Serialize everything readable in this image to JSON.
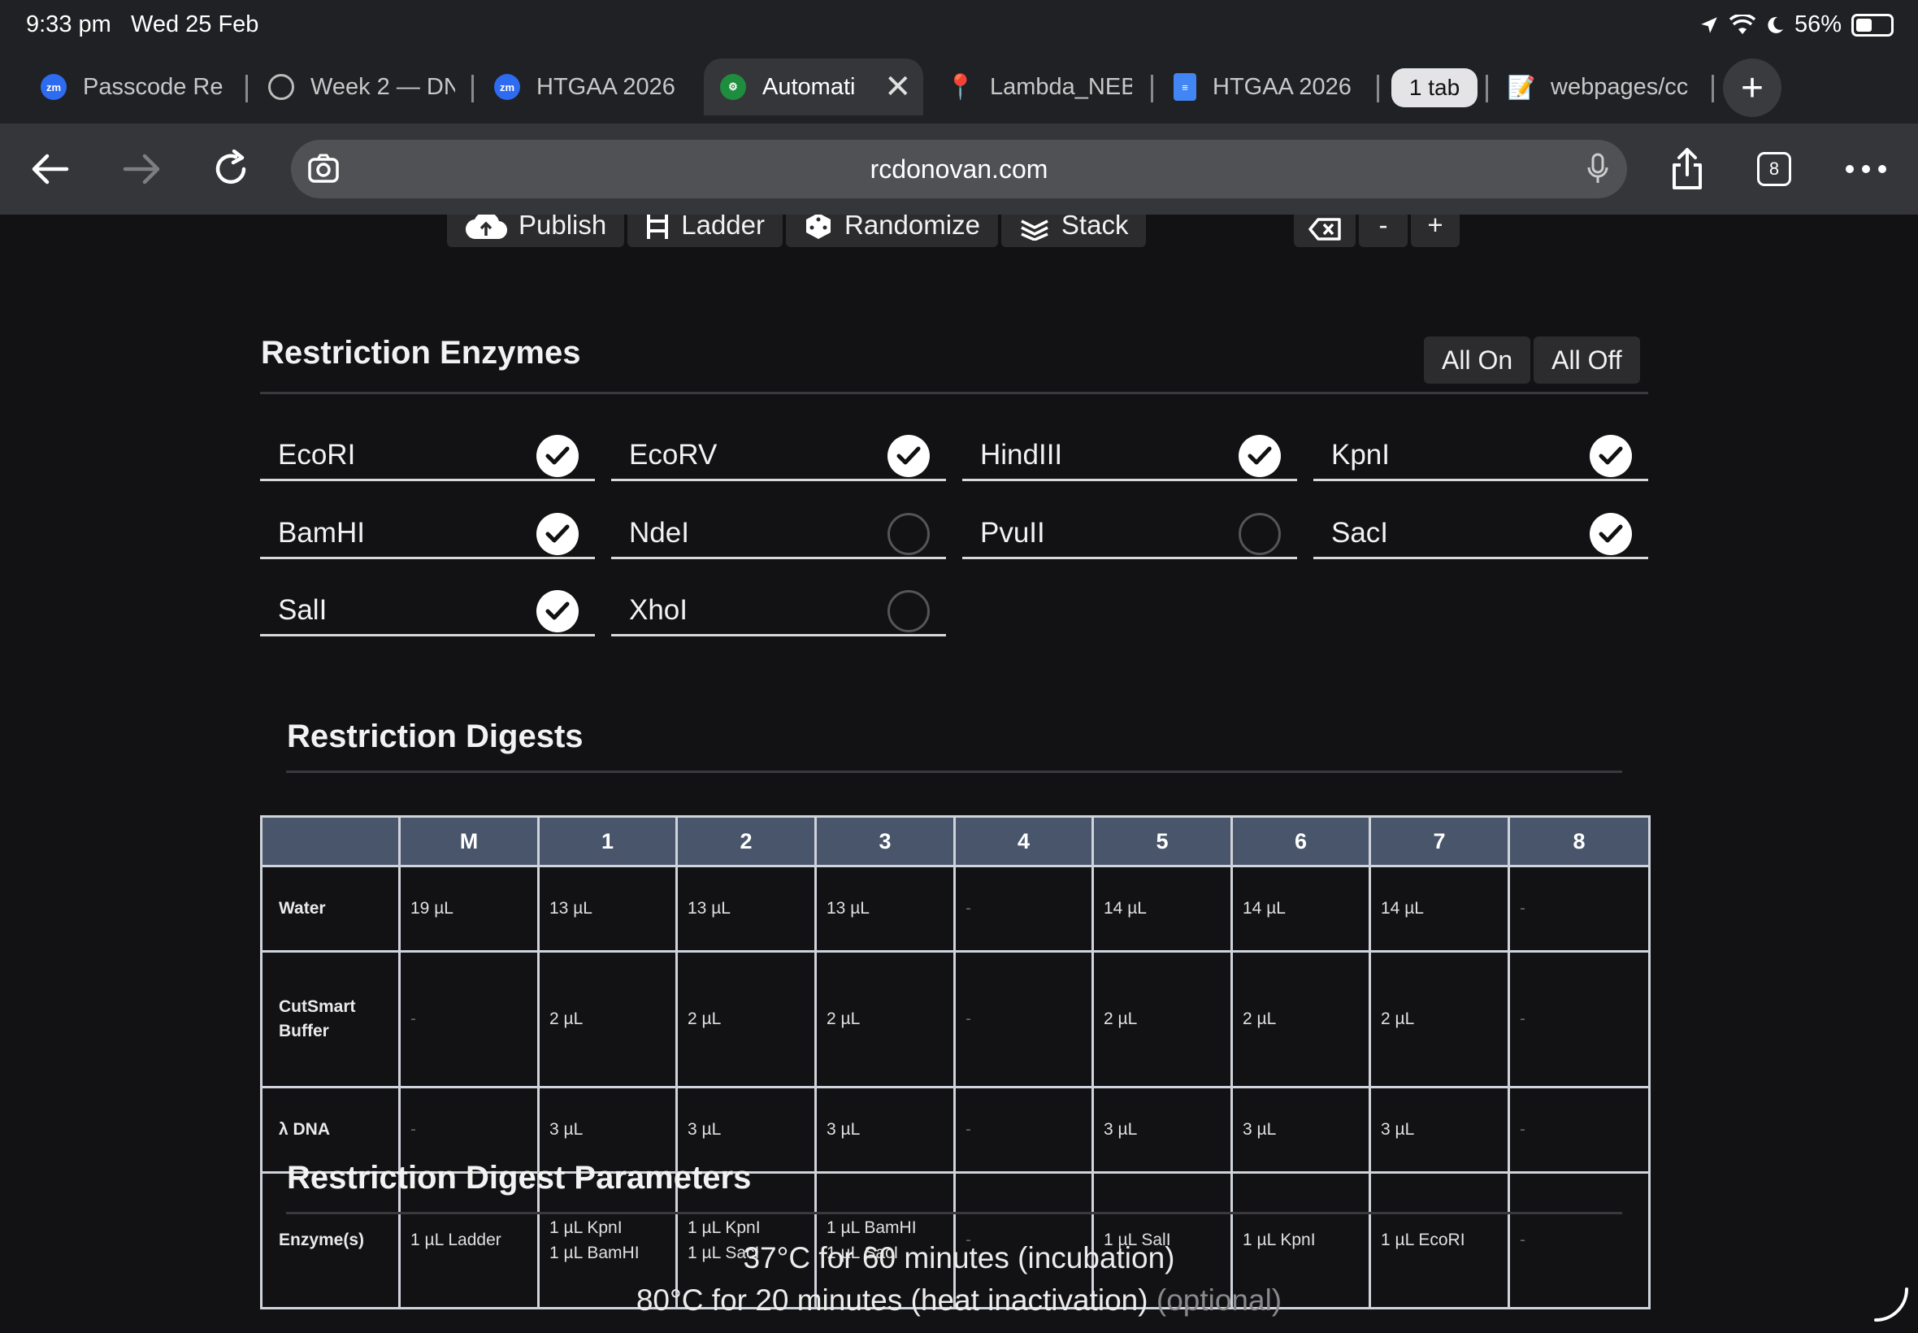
{
  "status_bar": {
    "time": "9:33 pm",
    "date": "Wed 25 Feb",
    "battery": "56%",
    "battery_fraction": 0.56
  },
  "tabs": [
    {
      "title": "Passcode Re",
      "favicon": "zoom-icon"
    },
    {
      "title": "Week 2 — DN",
      "favicon": "globe-icon"
    },
    {
      "title": "HTGAA 2026",
      "favicon": "zoom-icon"
    },
    {
      "title": "Automati",
      "favicon": "gear-icon",
      "active": true
    },
    {
      "title": "Lambda_NEB",
      "favicon": "pin-icon"
    },
    {
      "title": "HTGAA 2026",
      "favicon": "docs-icon"
    },
    {
      "title": "webpages/cc",
      "favicon": "memo-icon"
    }
  ],
  "tab_group_label": "1 tab",
  "toolbar": {
    "url": "rcdonovan.com",
    "tab_count": "8"
  },
  "action_buttons": {
    "publish": "Publish",
    "ladder": "Ladder",
    "randomize": "Randomize",
    "stack": "Stack"
  },
  "zoom_buttons": {
    "minus": "-",
    "plus": "+"
  },
  "enzymes_section": {
    "title": "Restriction Enzymes",
    "all_on": "All On",
    "all_off": "All Off",
    "enzymes": [
      {
        "name": "EcoRI",
        "checked": true
      },
      {
        "name": "EcoRV",
        "checked": true
      },
      {
        "name": "HindIII",
        "checked": true
      },
      {
        "name": "KpnI",
        "checked": true
      },
      {
        "name": "BamHI",
        "checked": true
      },
      {
        "name": "NdeI",
        "checked": false
      },
      {
        "name": "PvuII",
        "checked": false
      },
      {
        "name": "SacI",
        "checked": true
      },
      {
        "name": "SalI",
        "checked": true
      },
      {
        "name": "XhoI",
        "checked": false
      }
    ]
  },
  "digests_section": {
    "title": "Restriction Digests",
    "columns": [
      "",
      "M",
      "1",
      "2",
      "3",
      "4",
      "5",
      "6",
      "7",
      "8"
    ],
    "rows": [
      {
        "label": "Water",
        "cells": [
          "19 µL",
          "13 µL",
          "13 µL",
          "13 µL",
          "-",
          "14 µL",
          "14 µL",
          "14 µL",
          "-"
        ]
      },
      {
        "label": "CutSmart Buffer",
        "cells": [
          "-",
          "2 µL",
          "2 µL",
          "2 µL",
          "-",
          "2 µL",
          "2 µL",
          "2 µL",
          "-"
        ]
      },
      {
        "label": "λ DNA",
        "cells": [
          "-",
          "3 µL",
          "3 µL",
          "3 µL",
          "-",
          "3 µL",
          "3 µL",
          "3 µL",
          "-"
        ]
      },
      {
        "label": "Enzyme(s)",
        "cells": [
          "1 µL Ladder",
          "1 µL KpnI\n1 µL BamHI",
          "1 µL KpnI\n1 µL SacI",
          "1 µL BamHI\n1 µL SacI",
          "-",
          "1 µL SalI",
          "1 µL KpnI",
          "1 µL EcoRI",
          "-"
        ]
      }
    ]
  },
  "parameters_section": {
    "title": "Restriction Digest Parameters",
    "line1": "37°C for 60 minutes (incubation)",
    "line2": "80°C for 20 minutes (heat inactivation)",
    "line2_optional": "(optional)"
  }
}
